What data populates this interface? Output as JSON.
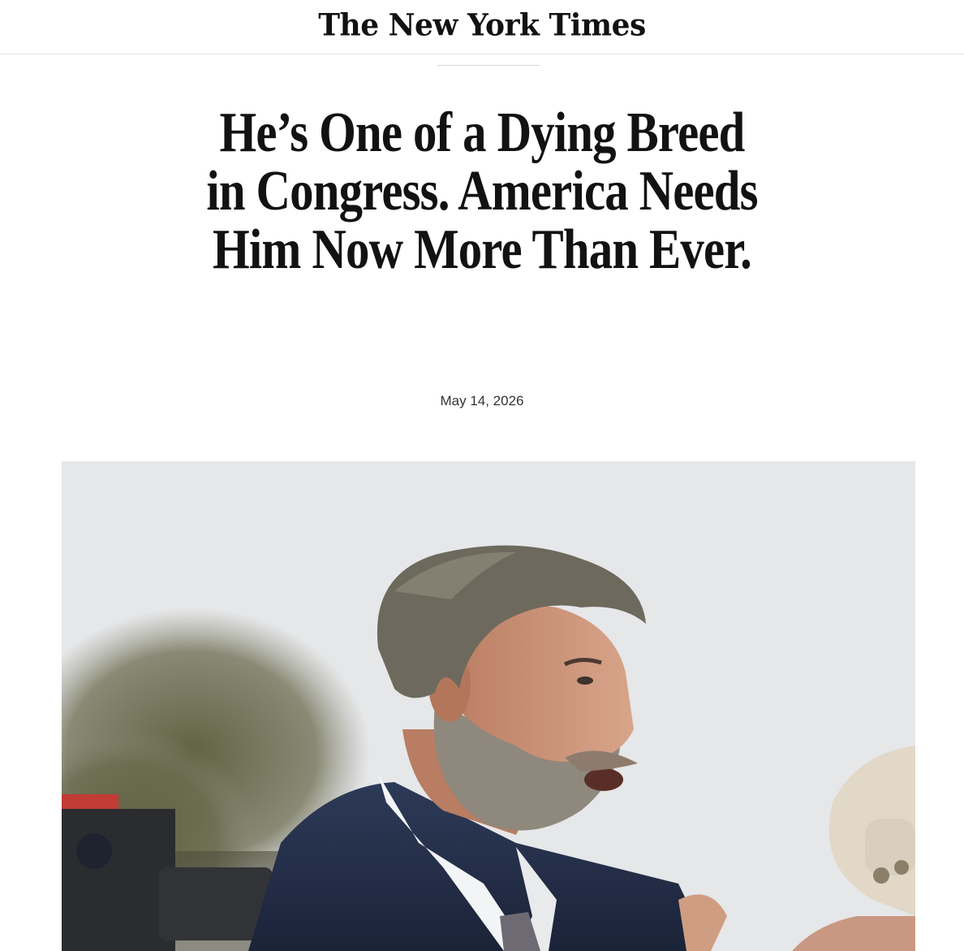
{
  "masthead": {
    "logo_text": "The New York Times"
  },
  "article": {
    "headline_lines": [
      "He’s One of a Dying Breed",
      "in Congress. America Needs",
      "Him Now More Than Ever."
    ],
    "date": "May 14, 2026"
  },
  "photo": {
    "subject": "man-speaking-portrait",
    "colors": {
      "sky": "#e6e7e9",
      "suit": "#25304a",
      "hair": "#6b6659",
      "skin": "#c98f74",
      "beard": "#8a8379"
    }
  }
}
